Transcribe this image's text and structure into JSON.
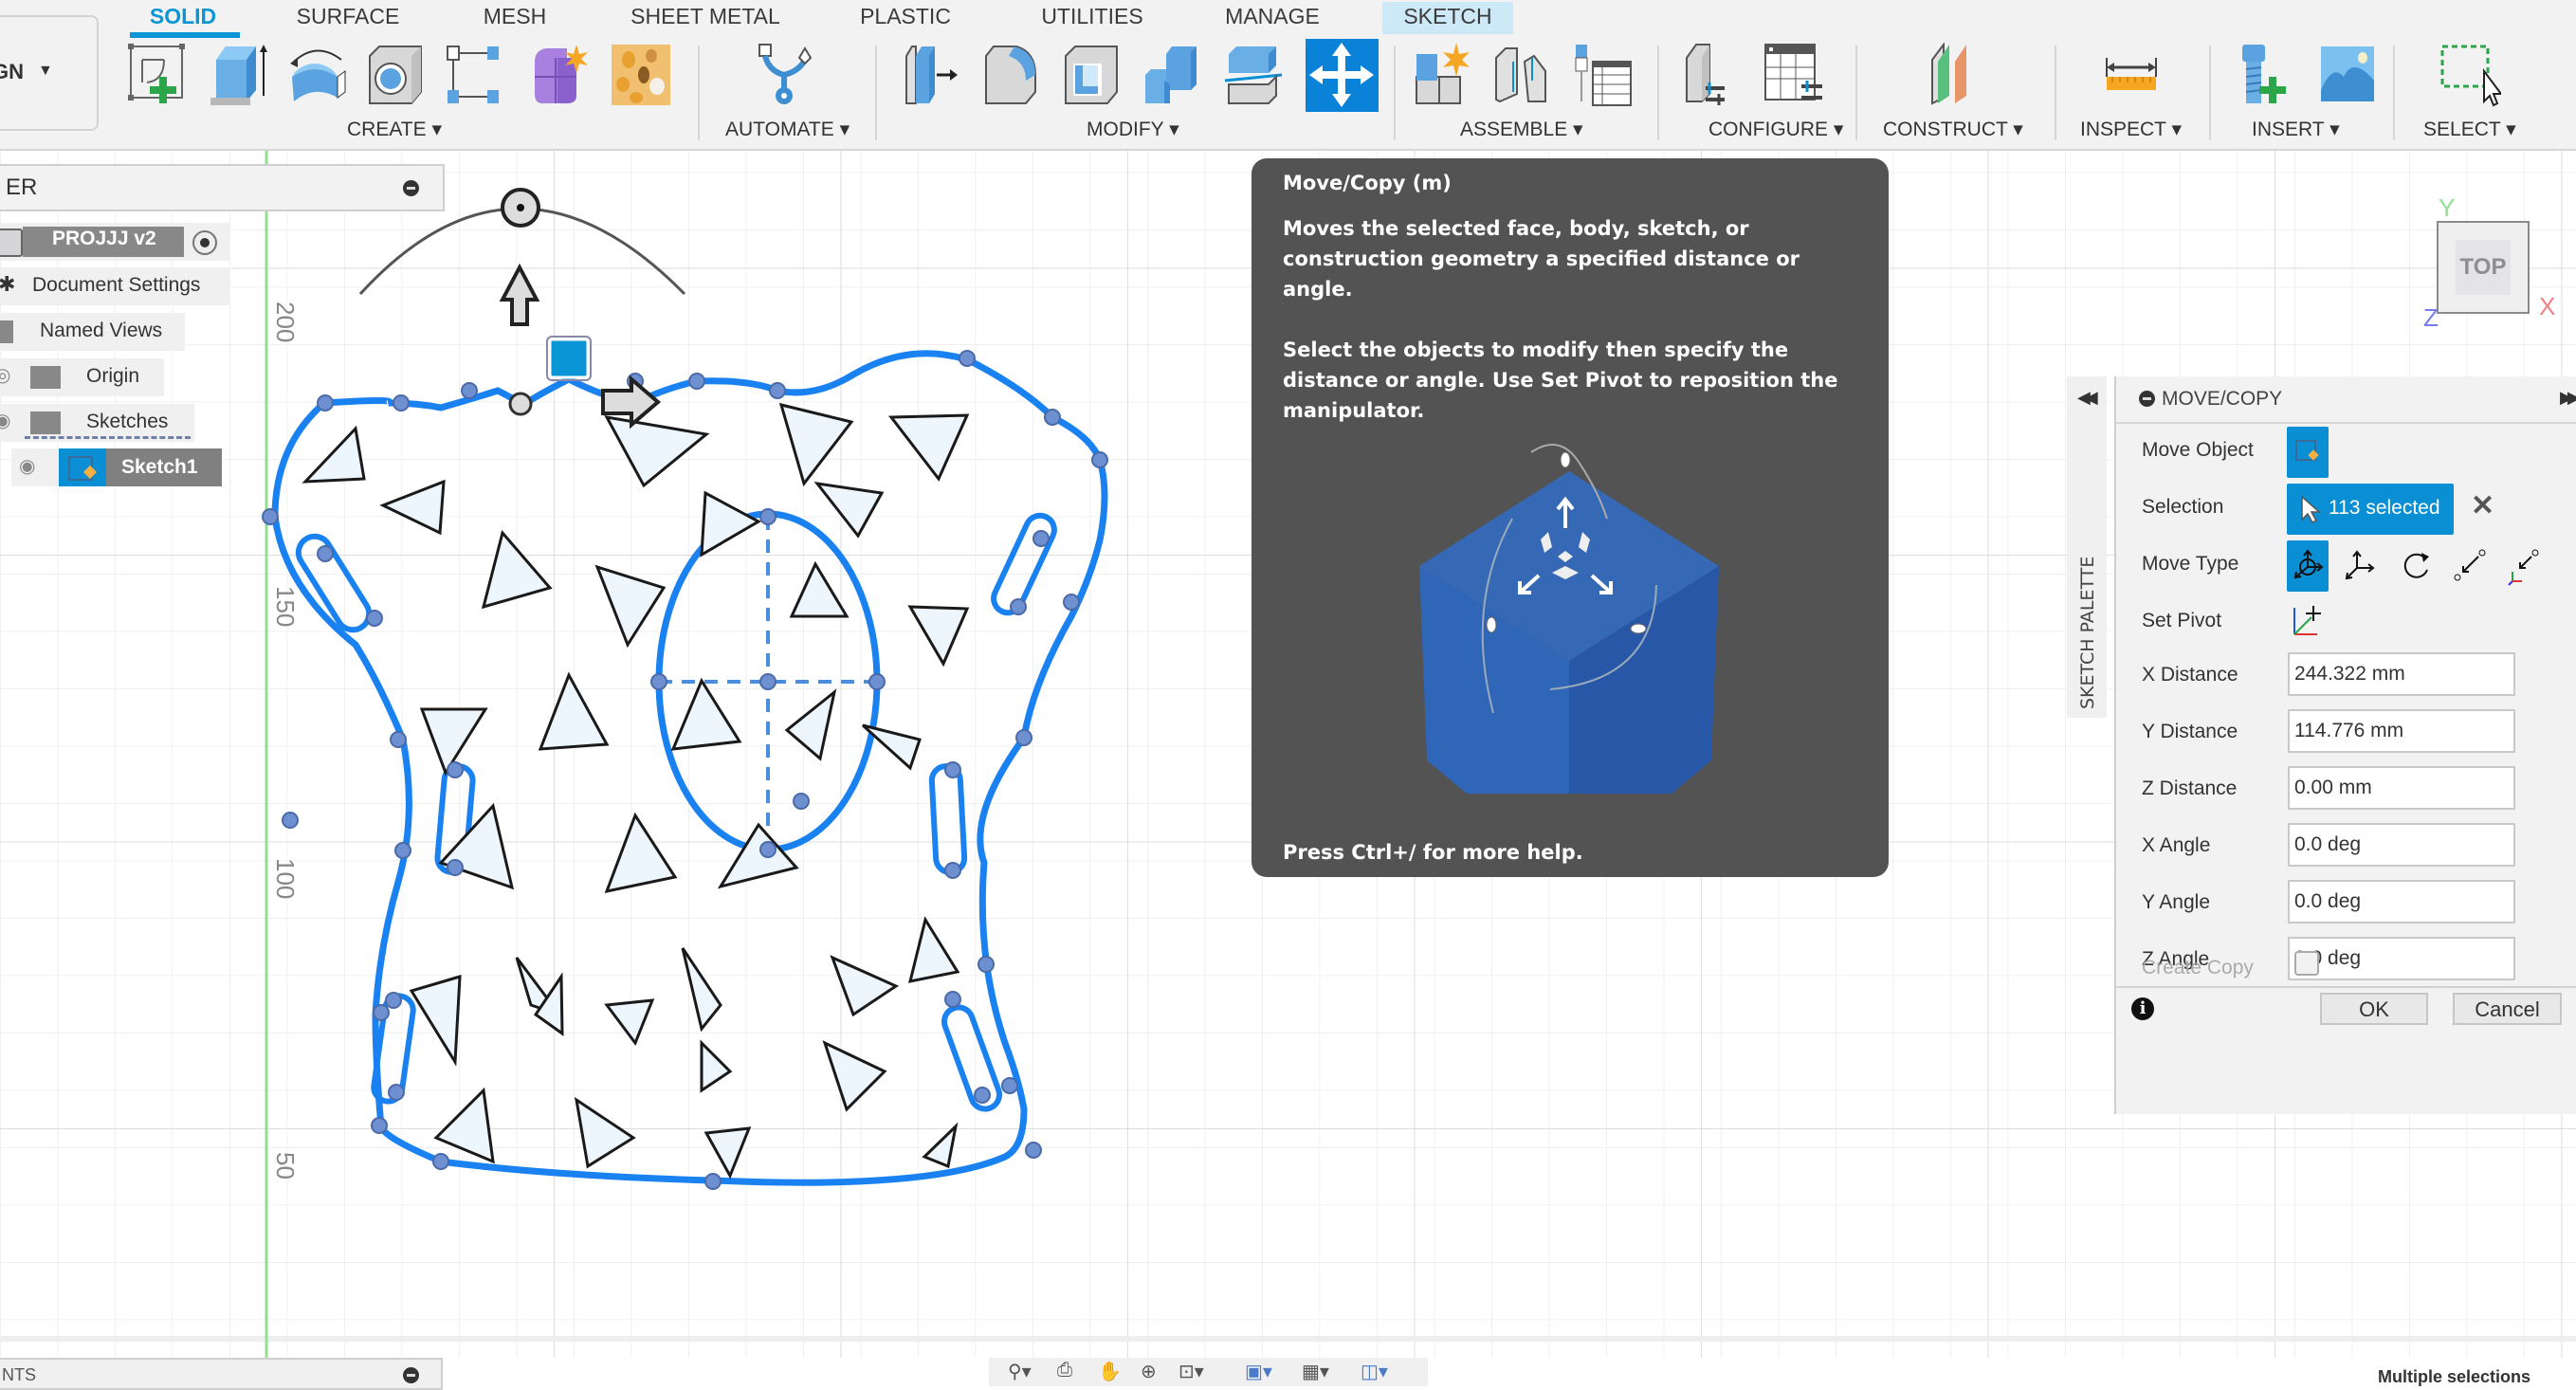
{
  "toolbar": {
    "workspace_button": "GN",
    "tabs": [
      {
        "label": "SOLID",
        "active": true
      },
      {
        "label": "SURFACE"
      },
      {
        "label": "MESH"
      },
      {
        "label": "SHEET METAL"
      },
      {
        "label": "PLASTIC"
      },
      {
        "label": "UTILITIES"
      },
      {
        "label": "MANAGE"
      },
      {
        "label": "SKETCH",
        "contextual": true
      }
    ],
    "groups": [
      {
        "label": "CREATE ▾",
        "icons": [
          "create-sketch-icon",
          "extrude-icon",
          "revolve-icon",
          "hole-icon",
          "rectangular-pattern-icon",
          "create-form-icon",
          "volumetric-lattice-icon"
        ]
      },
      {
        "label": "AUTOMATE ▾",
        "icons": [
          "automate-icon"
        ]
      },
      {
        "label": "MODIFY ▾",
        "icons": [
          "press-pull-icon",
          "fillet-icon",
          "shell-icon",
          "combine-icon",
          "split-body-icon",
          "move-copy-icon"
        ]
      },
      {
        "label": "ASSEMBLE ▾",
        "icons": [
          "new-component-icon",
          "joint-icon",
          "bill-of-materials-icon"
        ]
      },
      {
        "label": "CONFIGURE ▾",
        "icons": [
          "configure-icon",
          "configuration-table-icon"
        ]
      },
      {
        "label": "CONSTRUCT ▾",
        "icons": [
          "offset-plane-icon"
        ]
      },
      {
        "label": "INSPECT ▾",
        "icons": [
          "measure-icon"
        ]
      },
      {
        "label": "INSERT ▾",
        "icons": [
          "insert-mcmaster-icon",
          "insert-canvas-icon"
        ]
      },
      {
        "label": "SELECT ▾",
        "icons": [
          "window-select-icon"
        ]
      }
    ],
    "active_tool": "move-copy-icon",
    "accent_color": "#0a96d6"
  },
  "browser": {
    "title": "ER",
    "items": [
      {
        "label": "PROJJJ v2",
        "type": "document"
      },
      {
        "label": "Document Settings"
      },
      {
        "label": "Named Views"
      },
      {
        "label": "Origin"
      },
      {
        "label": "Sketches"
      },
      {
        "label": "Sketch1",
        "selected": true
      }
    ]
  },
  "canvas": {
    "ruler_labels": [
      "200",
      "150",
      "100",
      "50"
    ],
    "view_cube": {
      "face": "TOP",
      "axes": {
        "x": "X",
        "y": "Y",
        "z": "Z"
      }
    }
  },
  "tooltip": {
    "title": "Move/Copy (m)",
    "paragraph1": "Moves the selected face, body, sketch, or construction geometry a specified distance or angle.",
    "paragraph2": "Select the objects to modify then specify the distance or angle. Use Set Pivot to reposition the manipulator.",
    "footer": "Press Ctrl+/ for more help."
  },
  "sketch_palette": {
    "label": "SKETCH PALETTE"
  },
  "move_copy_panel": {
    "title": "MOVE/COPY",
    "move_object_label": "Move Object",
    "selection_label": "Selection",
    "selection_value": "113 selected",
    "move_type_label": "Move Type",
    "move_types": [
      "free-move",
      "translate",
      "rotate",
      "point-to-point",
      "point-to-position"
    ],
    "move_type_selected": "free-move",
    "set_pivot_label": "Set Pivot",
    "fields": [
      {
        "label": "X Distance",
        "value": "244.322 mm"
      },
      {
        "label": "Y Distance",
        "value": "114.776 mm"
      },
      {
        "label": "Z Distance",
        "value": "0.00 mm"
      },
      {
        "label": "X Angle",
        "value": "0.0 deg"
      },
      {
        "label": "Y Angle",
        "value": "0.0 deg"
      },
      {
        "label": "Z Angle",
        "value": "0.0 deg"
      }
    ],
    "create_copy_label": "Create Copy",
    "create_copy_checked": false,
    "ok_label": "OK",
    "cancel_label": "Cancel"
  },
  "bottom": {
    "comments_label": "NTS",
    "status_text": "Multiple selections"
  }
}
